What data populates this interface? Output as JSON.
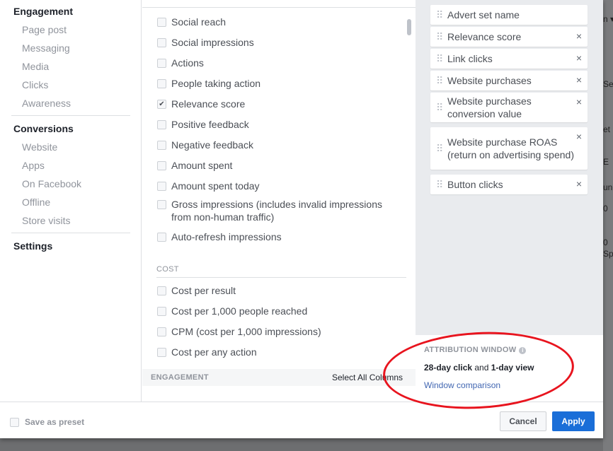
{
  "sidebar": {
    "groups": [
      {
        "title": "Engagement",
        "items": [
          "Page post",
          "Messaging",
          "Media",
          "Clicks",
          "Awareness"
        ]
      },
      {
        "title": "Conversions",
        "items": [
          "Website",
          "Apps",
          "On Facebook",
          "Offline",
          "Store visits"
        ]
      },
      {
        "title": "Settings",
        "items": []
      }
    ]
  },
  "columns": {
    "items": [
      {
        "label": "Social reach",
        "checked": false
      },
      {
        "label": "Social impressions",
        "checked": false
      },
      {
        "label": "Actions",
        "checked": false
      },
      {
        "label": "People taking action",
        "checked": false
      },
      {
        "label": "Relevance score",
        "checked": true
      },
      {
        "label": "Positive feedback",
        "checked": false
      },
      {
        "label": "Negative feedback",
        "checked": false
      },
      {
        "label": "Amount spent",
        "checked": false
      },
      {
        "label": "Amount spent today",
        "checked": false
      },
      {
        "label": "Gross impressions (includes invalid impressions from non-human traffic)",
        "checked": false
      },
      {
        "label": "Auto-refresh impressions",
        "checked": false
      }
    ],
    "cost_section": "COST",
    "cost_items": [
      {
        "label": "Cost per result",
        "checked": false
      },
      {
        "label": "Cost per 1,000 people reached",
        "checked": false
      },
      {
        "label": "CPM (cost per 1,000 impressions)",
        "checked": false
      },
      {
        "label": "Cost per any action",
        "checked": false
      }
    ],
    "engagement_header": "ENGAGEMENT",
    "select_all": "Select All Columns"
  },
  "selected": {
    "items": [
      {
        "label": "Advert set name",
        "removable": false
      },
      {
        "label": "Relevance score",
        "removable": true
      },
      {
        "label": "Link clicks",
        "removable": true
      },
      {
        "label": "Website purchases",
        "removable": true
      },
      {
        "label": "Website purchases conversion value",
        "removable": true
      },
      {
        "label": "Website purchase ROAS (return on advertising spend)",
        "removable": true
      },
      {
        "label": "Button clicks",
        "removable": true
      }
    ],
    "remove_icon": "×"
  },
  "attribution": {
    "title": "ATTRIBUTION WINDOW",
    "info_icon": "i",
    "click": "28-day click",
    "and": " and ",
    "view": "1-day view",
    "link": "Window comparison"
  },
  "footer": {
    "save_preset": "Save as preset",
    "cancel": "Cancel",
    "apply": "Apply"
  },
  "colors": {
    "accent": "#1a6ed8",
    "annotation": "#e8141e"
  }
}
